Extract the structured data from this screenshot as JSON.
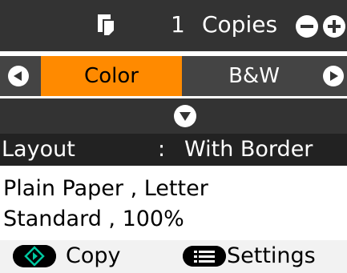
{
  "copies": {
    "count": "1",
    "label": "Copies"
  },
  "color_mode": {
    "options": [
      "Color",
      "B&W"
    ],
    "selected": "Color"
  },
  "layout": {
    "label": "Layout",
    "separator": ":",
    "value": "With Border"
  },
  "paper": {
    "line": "Plain Paper , Letter"
  },
  "quality": {
    "line": "Standard , 100%"
  },
  "footer": {
    "copy_label": "Copy",
    "settings_label": "Settings"
  },
  "colors": {
    "header_bg": "#333333",
    "selected_mode_bg": "#ff8a00",
    "layout_bg": "#222222",
    "footer_bg": "#f2f2f2"
  },
  "icons": {
    "copies": "copies-icon",
    "decrease": "minus-icon",
    "increase": "plus-icon",
    "prev": "left-arrow-icon",
    "next": "right-arrow-icon",
    "expand": "down-arrow-icon",
    "start": "start-icon",
    "menu": "menu-icon"
  }
}
